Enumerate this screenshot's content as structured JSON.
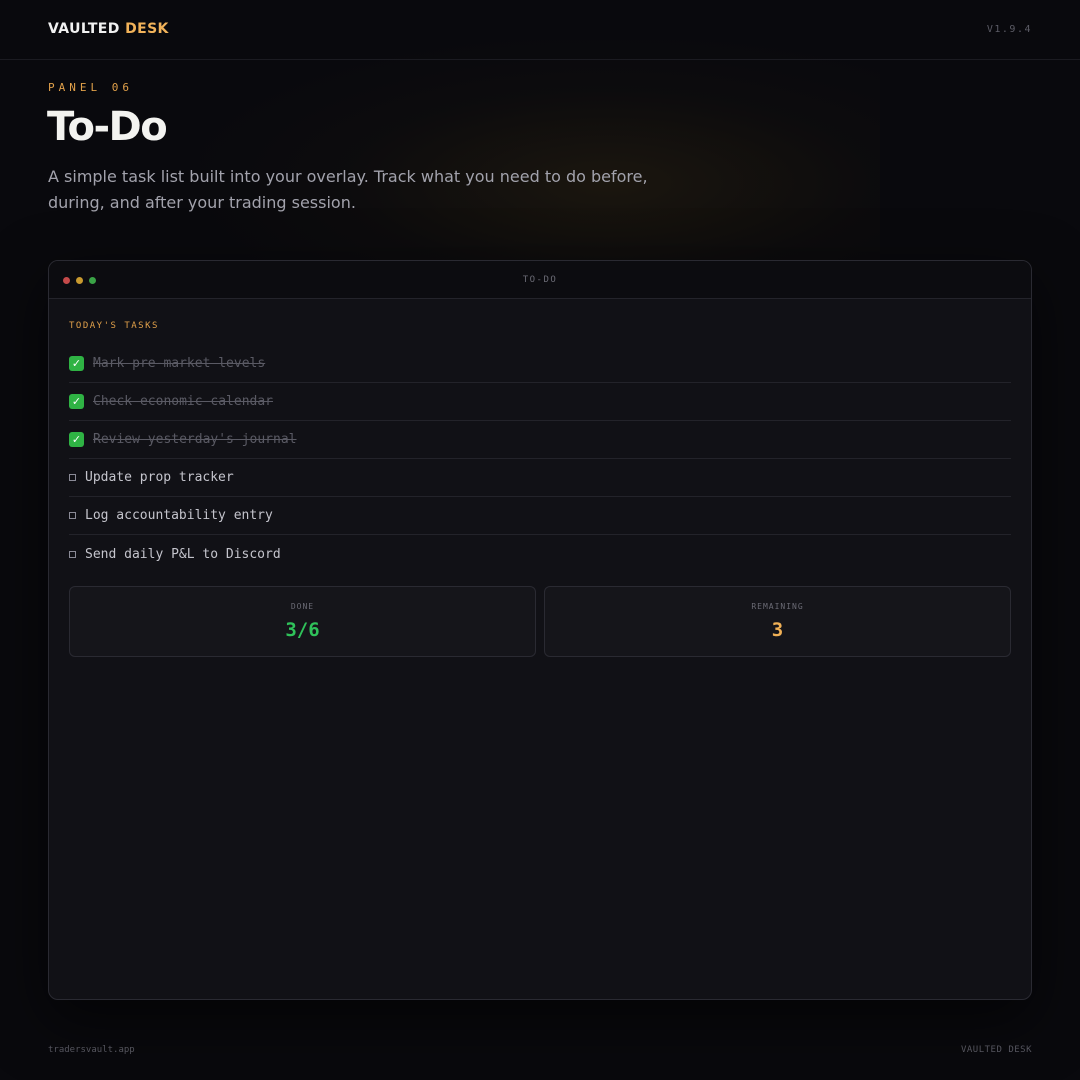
{
  "header": {
    "brand_primary": "VAULTED",
    "brand_accent": "DESK",
    "version": "V1.9.4"
  },
  "hero": {
    "eyebrow": "PANEL 06",
    "title": "To-Do",
    "description": "A simple task list built into your overlay. Track what you need to do before, during, and after your trading session."
  },
  "window": {
    "title": "TO-DO",
    "section_label": "TODAY'S TASKS",
    "tasks": [
      {
        "label": "Mark pre-market levels",
        "done": true
      },
      {
        "label": "Check economic calendar",
        "done": true
      },
      {
        "label": "Review yesterday's journal",
        "done": true
      },
      {
        "label": "Update prop tracker",
        "done": false
      },
      {
        "label": "Log accountability entry",
        "done": false
      },
      {
        "label": "Send daily P&L to Discord",
        "done": false
      }
    ],
    "stats": {
      "done_label": "DONE",
      "done_value": "3/6",
      "remaining_label": "REMAINING",
      "remaining_value": "3"
    }
  },
  "footer": {
    "left": "tradersvault.app",
    "right": "VAULTED DESK"
  },
  "colors": {
    "accent": "#f2b35a",
    "done_green": "#2fc25a",
    "background": "#09090d"
  }
}
